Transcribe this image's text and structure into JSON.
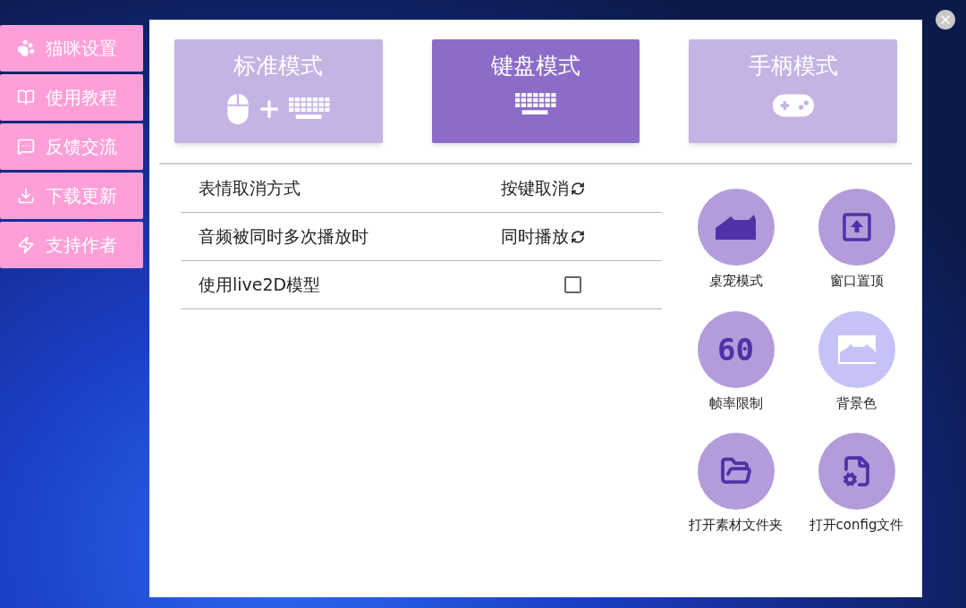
{
  "sidebar": {
    "items": [
      {
        "label": "猫咪设置",
        "kind": "paw"
      },
      {
        "label": "使用教程",
        "kind": "book"
      },
      {
        "label": "反馈交流",
        "kind": "chat"
      },
      {
        "label": "下载更新",
        "kind": "download"
      },
      {
        "label": "支持作者",
        "kind": "bolt"
      }
    ]
  },
  "modes": [
    {
      "label": "标准模式",
      "kind": "mouse_keyboard",
      "selected": false
    },
    {
      "label": "键盘模式",
      "kind": "keyboard",
      "selected": true
    },
    {
      "label": "手柄模式",
      "kind": "gamepad",
      "selected": false
    }
  ],
  "settings": [
    {
      "label": "表情取消方式",
      "kind": "cycle",
      "value": "按键取消"
    },
    {
      "label": "音频被同时多次播放时",
      "kind": "cycle",
      "value": "同时播放"
    },
    {
      "label": "使用live2D模型",
      "kind": "checkbox",
      "checked": false
    }
  ],
  "actions": [
    {
      "label": "桌宠模式",
      "kind": "cat",
      "dimmed": false
    },
    {
      "label": "窗口置顶",
      "kind": "pin_top",
      "dimmed": false
    },
    {
      "label": "帧率限制",
      "kind": "fps",
      "badge": "60",
      "dimmed": false
    },
    {
      "label": "背景色",
      "kind": "background",
      "dimmed": true
    },
    {
      "label": "打开素材文件夹",
      "kind": "folder",
      "dimmed": false
    },
    {
      "label": "打开config文件",
      "kind": "config",
      "dimmed": false
    }
  ]
}
